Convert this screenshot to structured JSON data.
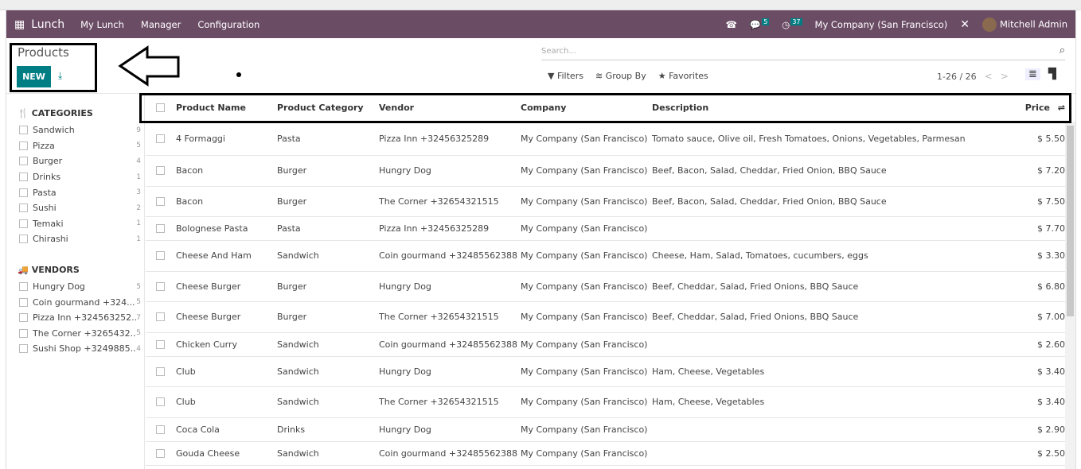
{
  "nav": {
    "app": "Lunch",
    "menus": [
      "My Lunch",
      "Manager",
      "Configuration"
    ],
    "messages_count": "5",
    "activities_count": "37",
    "company": "My Company (San Francisco)",
    "user": "Mitchell Admin"
  },
  "control": {
    "title": "Products",
    "new_label": "NEW",
    "search_placeholder": "Search...",
    "filters": "Filters",
    "group_by": "Group By",
    "favorites": "Favorites",
    "pager": "1-26 / 26"
  },
  "sidebar": {
    "categories_title": "CATEGORIES",
    "categories": [
      {
        "label": "Sandwich",
        "count": "9"
      },
      {
        "label": "Pizza",
        "count": "5"
      },
      {
        "label": "Burger",
        "count": "4"
      },
      {
        "label": "Drinks",
        "count": "1"
      },
      {
        "label": "Pasta",
        "count": "3"
      },
      {
        "label": "Sushi",
        "count": "2"
      },
      {
        "label": "Temaki",
        "count": "1"
      },
      {
        "label": "Chirashi",
        "count": "1"
      }
    ],
    "vendors_title": "VENDORS",
    "vendors": [
      {
        "label": "Hungry Dog",
        "count": "5"
      },
      {
        "label": "Coin gourmand +324...",
        "count": "5"
      },
      {
        "label": "Pizza Inn +324563252...",
        "count": "7"
      },
      {
        "label": "The Corner +3265432...",
        "count": "5"
      },
      {
        "label": "Sushi Shop +3249885...",
        "count": "4"
      }
    ]
  },
  "table": {
    "columns": [
      "Product Name",
      "Product Category",
      "Vendor",
      "Company",
      "Description",
      "Price"
    ],
    "rows": [
      [
        "4 Formaggi",
        "Pasta",
        "Pizza Inn +32456325289",
        "My Company (San Francisco)",
        "Tomato sauce, Olive oil, Fresh Tomatoes, Onions, Vegetables, Parmesan",
        "$ 5.50"
      ],
      [
        "Bacon",
        "Burger",
        "Hungry Dog",
        "My Company (San Francisco)",
        "Beef, Bacon, Salad, Cheddar, Fried Onion, BBQ Sauce",
        "$ 7.20"
      ],
      [
        "Bacon",
        "Burger",
        "The Corner +32654321515",
        "My Company (San Francisco)",
        "Beef, Bacon, Salad, Cheddar, Fried Onion, BBQ Sauce",
        "$ 7.50"
      ],
      [
        "Bolognese Pasta",
        "Pasta",
        "Pizza Inn +32456325289",
        "My Company (San Francisco)",
        "",
        "$ 7.70"
      ],
      [
        "Cheese And Ham",
        "Sandwich",
        "Coin gourmand +32485562388",
        "My Company (San Francisco)",
        "Cheese, Ham, Salad, Tomatoes, cucumbers, eggs",
        "$ 3.30"
      ],
      [
        "Cheese Burger",
        "Burger",
        "Hungry Dog",
        "My Company (San Francisco)",
        "Beef, Cheddar, Salad, Fried Onions, BBQ Sauce",
        "$ 6.80"
      ],
      [
        "Cheese Burger",
        "Burger",
        "The Corner +32654321515",
        "My Company (San Francisco)",
        "Beef, Cheddar, Salad, Fried Onions, BBQ Sauce",
        "$ 7.00"
      ],
      [
        "Chicken Curry",
        "Sandwich",
        "Coin gourmand +32485562388",
        "My Company (San Francisco)",
        "",
        "$ 2.60"
      ],
      [
        "Club",
        "Sandwich",
        "Hungry Dog",
        "My Company (San Francisco)",
        "Ham, Cheese, Vegetables",
        "$ 3.40"
      ],
      [
        "Club",
        "Sandwich",
        "The Corner +32654321515",
        "My Company (San Francisco)",
        "Ham, Cheese, Vegetables",
        "$ 3.40"
      ],
      [
        "Coca Cola",
        "Drinks",
        "Hungry Dog",
        "My Company (San Francisco)",
        "",
        "$ 2.90"
      ],
      [
        "Gouda Cheese",
        "Sandwich",
        "Coin gourmand +32485562388",
        "My Company (San Francisco)",
        "",
        "$ 2.50"
      ]
    ]
  },
  "colors": {
    "navbar": "#6b4c65",
    "accent": "#017e84"
  }
}
